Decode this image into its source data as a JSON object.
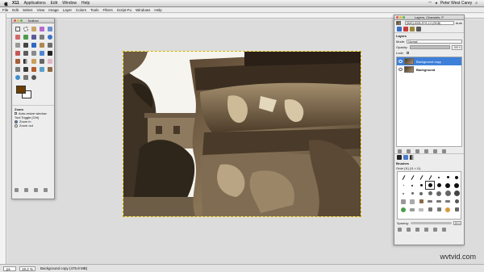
{
  "macbar": {
    "app": "X11",
    "menus": [
      "Applications",
      "Edit",
      "Window",
      "Help"
    ],
    "user": "Peter West Carey"
  },
  "gimp_menu": [
    "File",
    "Edit",
    "Select",
    "View",
    "Image",
    "Layer",
    "Colors",
    "Tools",
    "Filters",
    "Script-Fu",
    "Windows",
    "Help"
  ],
  "toolbox": {
    "title": "Toolbox",
    "options": {
      "header": "Zoom",
      "auto_resize": "Auto-resize window",
      "toggle_label": "Tool Toggle (Ctrl)",
      "zoom_in": "Zoom in",
      "zoom_out": "Zoom out"
    },
    "fg_color": "#6b3d00",
    "bg_color": "#ffffff"
  },
  "dock": {
    "title": "Layers, Channels, P",
    "image_select": "[IMG]-0005.JPG-1.0 (RGB)",
    "auto_label": "Auto",
    "section": "Layers",
    "mode_label": "Mode:",
    "mode_value": "Normal",
    "opacity_label": "Opacity:",
    "opacity_value": "100.0",
    "lock_label": "Lock:",
    "layers": [
      {
        "name": "Background copy",
        "active": true
      },
      {
        "name": "Background",
        "active": false
      }
    ],
    "brushes_title": "Brushes",
    "brush_name": "Circle (11) (11 × 11)",
    "spacing_label": "Spacing:",
    "spacing_value": "20.0"
  },
  "status": {
    "unit": "px",
    "zoom": "18.2 %",
    "text": "Background copy (475.8 MB)"
  },
  "watermark": "wvtvid.com"
}
